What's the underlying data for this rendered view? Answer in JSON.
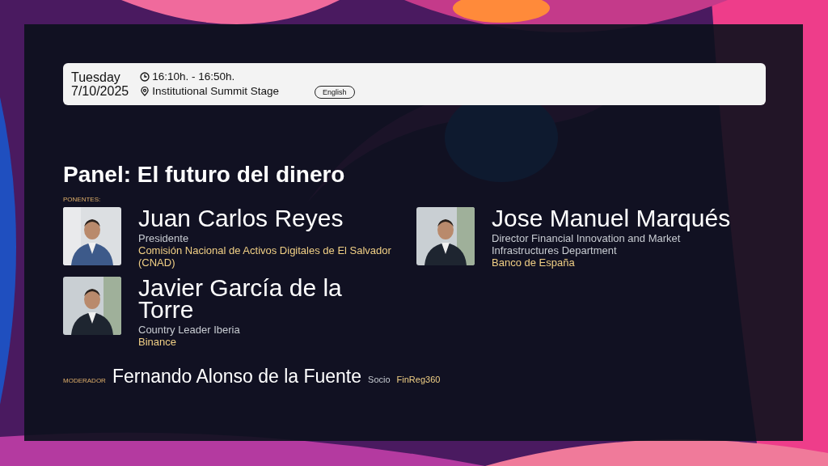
{
  "event": {
    "day": "Tuesday",
    "date": "7/10/2025",
    "time": "16:10h. - 16:50h.",
    "location": "Institutional Summit Stage",
    "language": "English"
  },
  "title": "Panel: El futuro del dinero",
  "speakers_label": "PONENTES:",
  "speaker_columns": [
    [
      {
        "name": "Juan Carlos Reyes",
        "role": "Presidente",
        "organization": "Comisión Nacional de Activos Digitales de El Salvador (CNAD)"
      },
      {
        "name": "Javier García de la Torre",
        "role": "Country Leader Iberia",
        "organization": "Binance"
      }
    ],
    [
      {
        "name": "Jose Manuel Marqués",
        "role": "Director Financial Innovation and Market Infrastructures Department",
        "organization": "Banco de España"
      }
    ]
  ],
  "moderator": {
    "label": "MODERADOR",
    "name": "Fernando Alonso de la Fuente",
    "role": "Socio",
    "organization": "FinReg360"
  }
}
